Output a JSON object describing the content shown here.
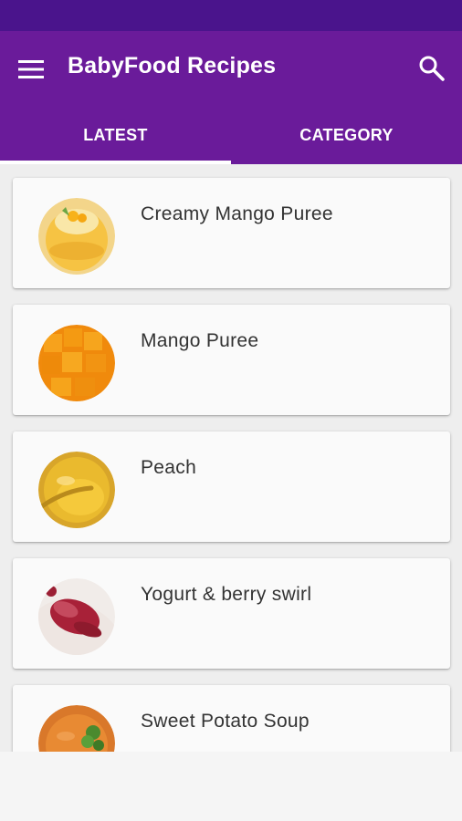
{
  "app": {
    "title": "BabyFood Recipes",
    "primary_color": "#6a1b9a",
    "status_bar_color": "#4a148c"
  },
  "toolbar": {
    "menu_icon": "menu-icon",
    "search_icon": "search-icon"
  },
  "tabs": [
    {
      "label": "LATEST",
      "selected": true
    },
    {
      "label": "CATEGORY",
      "selected": false
    }
  ],
  "recipes": [
    {
      "title": "Creamy Mango Puree",
      "image": "creamy-mango-puree-image"
    },
    {
      "title": "Mango Puree",
      "image": "mango-cubes-image"
    },
    {
      "title": "Peach",
      "image": "peach-puree-image"
    },
    {
      "title": "Yogurt & berry swirl",
      "image": "yogurt-berry-swirl-image"
    },
    {
      "title": "Sweet Potato Soup",
      "image": "sweet-potato-soup-image"
    }
  ]
}
